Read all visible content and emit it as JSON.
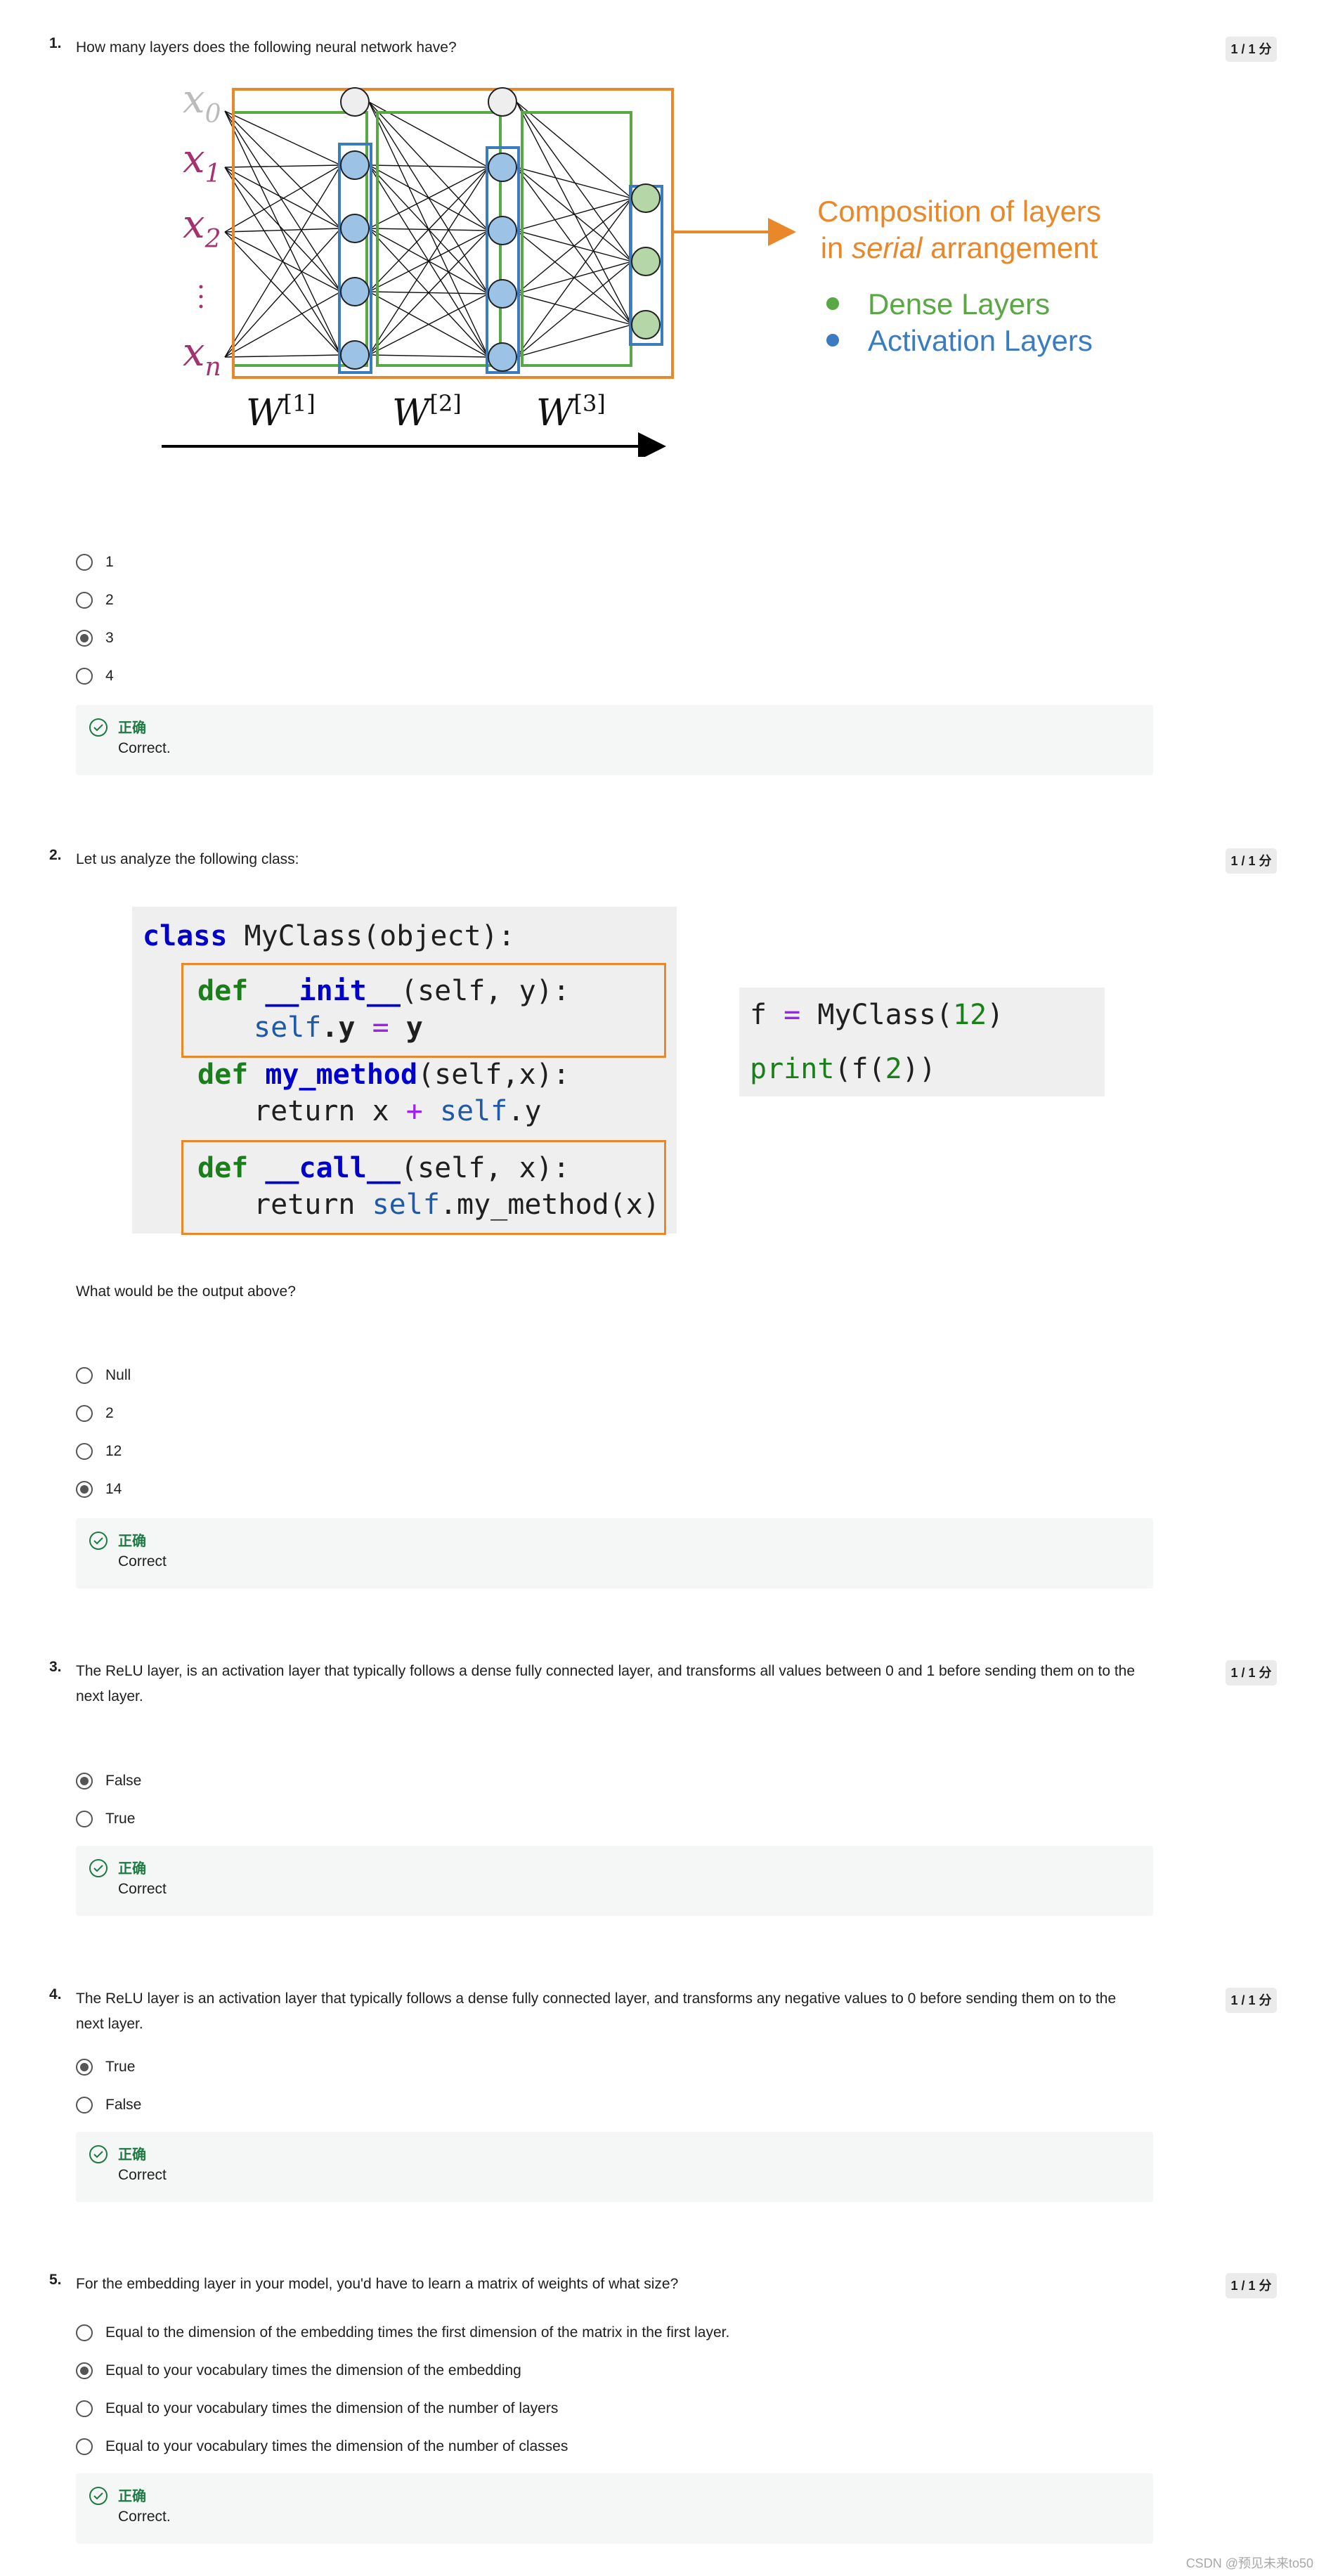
{
  "questions": [
    {
      "number": "1.",
      "text": "How many layers does the following neural network have?",
      "score": "1 / 1 分",
      "figure": {
        "input_labels": [
          "x",
          "x",
          "x",
          "x"
        ],
        "input_subscripts": [
          "0",
          "1",
          "2",
          "n"
        ],
        "weight_labels": [
          "W",
          "W",
          "W"
        ],
        "weight_superscripts": [
          "[1]",
          "[2]",
          "[3]"
        ],
        "caption_line1": "Composition of layers",
        "caption_line2_prefix": "in ",
        "caption_line2_italic": "serial",
        "caption_line2_suffix": " arrangement",
        "legend": [
          "Dense Layers",
          "Activation Layers"
        ],
        "colors": {
          "orange": "#e8882a",
          "green": "#5aa845",
          "blue": "#3a7cc0",
          "purple": "#a3336e"
        }
      },
      "options": [
        "1",
        "2",
        "3",
        "4"
      ],
      "selected": 2,
      "feedback_title": "正确",
      "feedback_text": "Correct."
    },
    {
      "number": "2.",
      "text": "Let us analyze the following class:",
      "score": "1 / 1 分",
      "code_left": {
        "line1": [
          "class",
          " MyClass(object):"
        ],
        "line2": [
          "def",
          " ",
          "__init__",
          "(self, y):"
        ],
        "line3": [
          "self",
          ".y ",
          "=",
          " y"
        ],
        "line4": [
          "def",
          " ",
          "my_method",
          "(self,x):"
        ],
        "line5": [
          "return x ",
          "+",
          " ",
          "self",
          ".y"
        ],
        "line6": [
          "def",
          " ",
          "__call__",
          "(self, x):"
        ],
        "line7": [
          "return ",
          "self",
          ".my_method(x)"
        ]
      },
      "code_right": {
        "line1": [
          "f ",
          "=",
          " MyClass(",
          "12",
          ")"
        ],
        "line2": [
          "print",
          "(f(",
          "2",
          "))"
        ]
      },
      "subtext": "What would be the output above?",
      "options": [
        "Null",
        "2",
        "12",
        "14"
      ],
      "selected": 3,
      "feedback_title": "正确",
      "feedback_text": "Correct"
    },
    {
      "number": "3.",
      "text": "The ReLU layer, is an activation layer that typically follows a dense fully connected layer, and transforms all values between 0 and 1 before sending them on to the next layer.",
      "score": "1 / 1 分",
      "options": [
        "False",
        "True"
      ],
      "selected": 0,
      "feedback_title": "正确",
      "feedback_text": "Correct"
    },
    {
      "number": "4.",
      "text": "The ReLU layer is an activation layer that typically follows a dense fully connected layer, and transforms any negative values to 0 before sending them on to the next layer.",
      "score": "1 / 1 分",
      "options": [
        "True",
        "False"
      ],
      "selected": 0,
      "feedback_title": "正确",
      "feedback_text": "Correct"
    },
    {
      "number": "5.",
      "text": "For the embedding layer in your model, you'd have to learn a matrix of weights of what size?",
      "score": "1 / 1 分",
      "options": [
        "Equal to the dimension of the embedding times the first dimension of the matrix in the first layer.",
        "Equal to your vocabulary times the dimension of the embedding",
        "Equal to your vocabulary times the dimension of the number of layers",
        "Equal to your vocabulary times the dimension of the number of classes"
      ],
      "selected": 1,
      "feedback_title": "正确",
      "feedback_text": "Correct."
    }
  ],
  "watermark": "CSDN @预见未来to50"
}
